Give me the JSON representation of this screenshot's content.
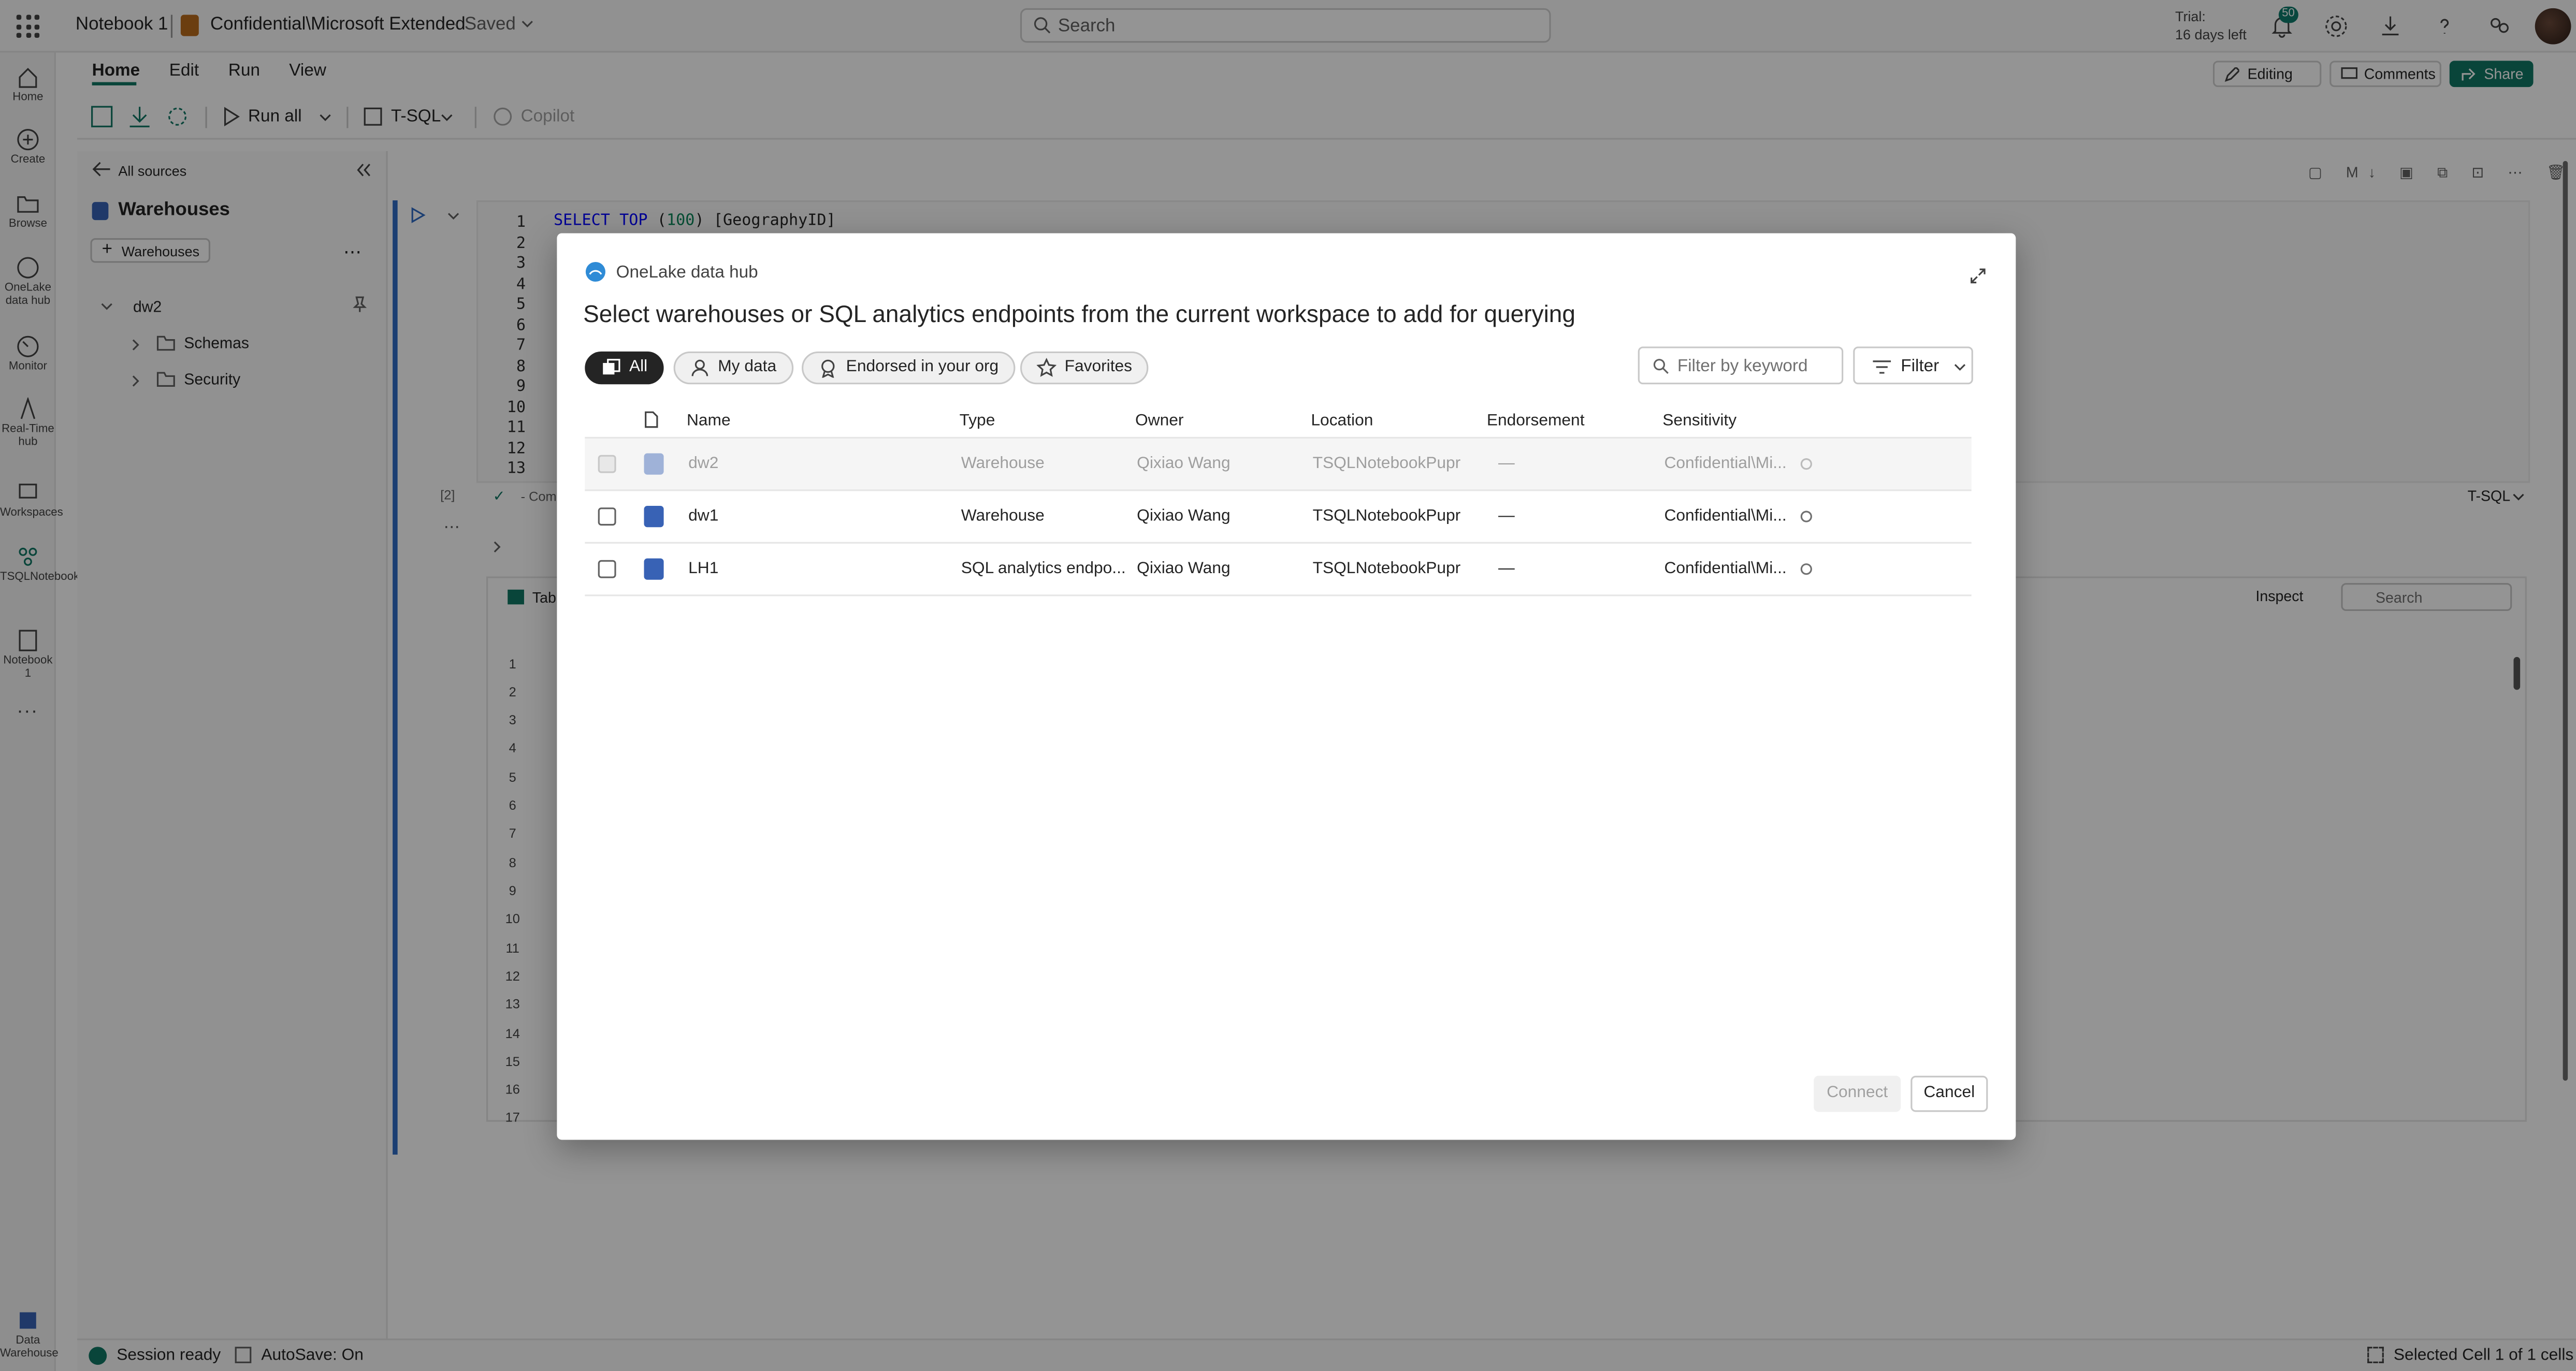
{
  "topbar": {
    "notebook_name": "Notebook 1",
    "label": "Confidential\\Microsoft Extended",
    "saved": "· Saved",
    "search_placeholder": "Search",
    "trial_line1": "Trial:",
    "trial_line2": "16 days left",
    "notification_count": "50"
  },
  "ribbon": {
    "tabs": [
      "Home",
      "Edit",
      "Run",
      "View"
    ],
    "editing": "Editing",
    "comments": "Comments",
    "share": "Share",
    "run_all": "Run all",
    "language": "T-SQL",
    "copilot": "Copilot"
  },
  "leftnav": {
    "items": [
      "Home",
      "Create",
      "Browse",
      "OneLake data hub",
      "Monitor",
      "Real-Time hub",
      "Workspaces",
      "TSQLNotebookPupr",
      "Notebook 1"
    ],
    "bottom": "Data Warehouse",
    "more": "..."
  },
  "explorer": {
    "back": "All sources",
    "title": "Warehouses",
    "add_button": "Warehouses",
    "root": "dw2",
    "children": [
      "Schemas",
      "Security"
    ]
  },
  "editor": {
    "line_numbers": [
      "1",
      "2",
      "3",
      "4",
      "5",
      "6",
      "7",
      "8",
      "9",
      "10",
      "11",
      "12",
      "13"
    ],
    "code_parts": [
      "SELECT",
      "TOP",
      "(",
      "100",
      ")",
      "[GeographyID]"
    ],
    "exec_count": "[2]",
    "status_prefix": "- Com",
    "lang_badge": "T-SQL",
    "results_tab": "Tabl",
    "inspect": "Inspect",
    "results_search": "Search",
    "row_numbers": [
      "1",
      "2",
      "3",
      "4",
      "5",
      "6",
      "7",
      "8",
      "9",
      "10",
      "11",
      "12",
      "13",
      "14",
      "15",
      "16",
      "17"
    ]
  },
  "statusbar": {
    "session": "Session ready",
    "autosave": "AutoSave: On",
    "selected": "Selected Cell 1 of 1 cells"
  },
  "dialog": {
    "hub_name": "OneLake data hub",
    "title": "Select warehouses or SQL analytics endpoints from the current workspace to add for querying",
    "pills": [
      "All",
      "My data",
      "Endorsed in your org",
      "Favorites"
    ],
    "filter_placeholder": "Filter by keyword",
    "filter_button": "Filter",
    "columns": [
      "Name",
      "Type",
      "Owner",
      "Location",
      "Endorsement",
      "Sensitivity"
    ],
    "rows": [
      {
        "name": "dw2",
        "type": "Warehouse",
        "owner": "Qixiao Wang",
        "location": "TSQLNotebookPupr",
        "endorsement": "—",
        "sensitivity": "Confidential\\Mi..."
      },
      {
        "name": "dw1",
        "type": "Warehouse",
        "owner": "Qixiao Wang",
        "location": "TSQLNotebookPupr",
        "endorsement": "—",
        "sensitivity": "Confidential\\Mi..."
      },
      {
        "name": "LH1",
        "type": "SQL analytics endpo...",
        "owner": "Qixiao Wang",
        "location": "TSQLNotebookPupr",
        "endorsement": "—",
        "sensitivity": "Confidential\\Mi..."
      }
    ],
    "connect": "Connect",
    "cancel": "Cancel"
  },
  "colors": {
    "accent": "#117865",
    "warehouse_icon": "#3862b5",
    "cell_bar": "#2f6bc4"
  }
}
